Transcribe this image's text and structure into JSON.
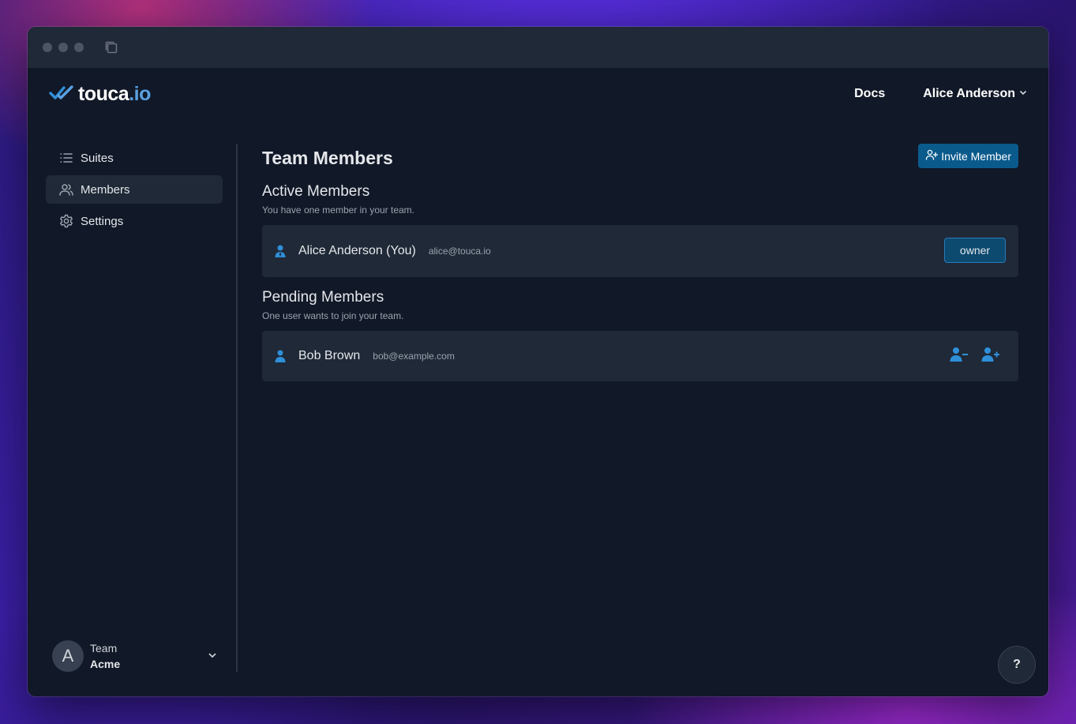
{
  "window": {
    "traffic_lights": [
      "close",
      "minimize",
      "maximize"
    ],
    "titlebar_icon": "copy-icon"
  },
  "header": {
    "logo": {
      "text_main": "touca",
      "text_accent": ".io",
      "icon": "double-check-logo-icon"
    },
    "docs_label": "Docs",
    "user_name": "Alice Anderson",
    "user_menu_icon": "chevron-down-icon"
  },
  "sidebar": {
    "items": [
      {
        "label": "Suites",
        "icon": "list-icon",
        "active": false
      },
      {
        "label": "Members",
        "icon": "users-icon",
        "active": true
      },
      {
        "label": "Settings",
        "icon": "gear-icon",
        "active": false
      }
    ],
    "team": {
      "avatar_letter": "A",
      "label": "Team",
      "name": "Acme"
    }
  },
  "main": {
    "title": "Team Members",
    "invite_label": "Invite Member",
    "active": {
      "title": "Active Members",
      "subtitle": "You have one member in your team.",
      "members": [
        {
          "name": "Alice Anderson (You)",
          "email": "alice@touca.io",
          "role": "owner"
        }
      ]
    },
    "pending": {
      "title": "Pending Members",
      "subtitle": "One user wants to join your team.",
      "members": [
        {
          "name": "Bob Brown",
          "email": "bob@example.com"
        }
      ]
    }
  },
  "help_label": "?",
  "colors": {
    "accent": "#0b5a8c",
    "icon_blue": "#2f8fd8",
    "background": "#111827",
    "surface": "#1f2937"
  }
}
